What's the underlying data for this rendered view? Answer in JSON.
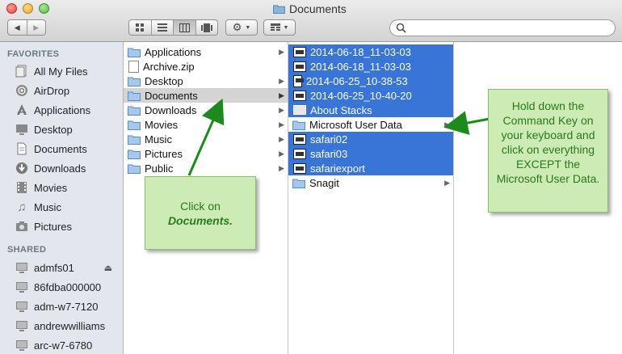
{
  "window": {
    "title": "Documents"
  },
  "toolbar": {
    "back_glyph": "◀",
    "forward_glyph": "▶",
    "views": [
      "icon-view",
      "list-view",
      "column-view",
      "coverflow-view"
    ],
    "action_icon": "gear-icon",
    "arrange_icon": "arrange-icon",
    "search_placeholder": ""
  },
  "sidebar": {
    "favorites_header": "FAVORITES",
    "favorites": [
      {
        "label": "All My Files",
        "icon": "all-files-icon"
      },
      {
        "label": "AirDrop",
        "icon": "airdrop-icon"
      },
      {
        "label": "Applications",
        "icon": "applications-icon"
      },
      {
        "label": "Desktop",
        "icon": "desktop-icon"
      },
      {
        "label": "Documents",
        "icon": "documents-icon"
      },
      {
        "label": "Downloads",
        "icon": "downloads-icon"
      },
      {
        "label": "Movies",
        "icon": "movies-icon"
      },
      {
        "label": "Music",
        "icon": "music-icon"
      },
      {
        "label": "Pictures",
        "icon": "pictures-icon"
      }
    ],
    "shared_header": "SHARED",
    "shared": [
      {
        "label": "admfs01",
        "icon": "computer-icon",
        "eject": "⏏"
      },
      {
        "label": "86fdba000000",
        "icon": "computer-icon"
      },
      {
        "label": "adm-w7-7120",
        "icon": "computer-icon"
      },
      {
        "label": "andrewwilliams",
        "icon": "computer-icon"
      },
      {
        "label": "arc-w7-6780",
        "icon": "computer-icon"
      }
    ]
  },
  "column1": [
    {
      "label": "Applications",
      "type": "folder",
      "arrow": true
    },
    {
      "label": "Archive.zip",
      "type": "file",
      "arrow": false
    },
    {
      "label": "Desktop",
      "type": "folder",
      "arrow": true
    },
    {
      "label": "Documents",
      "type": "folder",
      "arrow": true,
      "selected": true
    },
    {
      "label": "Downloads",
      "type": "folder",
      "arrow": true
    },
    {
      "label": "Movies",
      "type": "folder",
      "arrow": true
    },
    {
      "label": "Music",
      "type": "folder",
      "arrow": true
    },
    {
      "label": "Pictures",
      "type": "folder",
      "arrow": true
    },
    {
      "label": "Public",
      "type": "folder",
      "arrow": true
    }
  ],
  "column2": [
    {
      "label": "2014-06-18_11-03-03",
      "type": "screenshot",
      "selected": true
    },
    {
      "label": "2014-06-18_11-03-03",
      "type": "screenshot",
      "selected": true
    },
    {
      "label": "2014-06-25_10-38-53",
      "type": "screenshot",
      "selected": true
    },
    {
      "label": "2014-06-25_10-40-20",
      "type": "screenshot",
      "selected": true
    },
    {
      "label": "About Stacks",
      "type": "doc",
      "selected": true
    },
    {
      "label": "Microsoft User Data",
      "type": "folder",
      "selected": false,
      "arrow": true
    },
    {
      "label": "safari02",
      "type": "screenshot",
      "selected": true
    },
    {
      "label": "safari03",
      "type": "screenshot",
      "selected": true
    },
    {
      "label": "safariexport",
      "type": "screenshot",
      "selected": true
    },
    {
      "label": "Snagit",
      "type": "folder",
      "selected": false,
      "arrow": true
    }
  ],
  "callouts": {
    "left": {
      "line1": "Click on",
      "line2": "Documents."
    },
    "right": {
      "text": "Hold down the Command Key on your keyboard and click on everything EXCEPT the Microsoft User Data."
    }
  },
  "colors": {
    "selection_blue": "#3875d7",
    "callout_bg": "#ccebb5",
    "callout_text": "#2a7a1b",
    "arrow_green": "#1e8a1e"
  }
}
